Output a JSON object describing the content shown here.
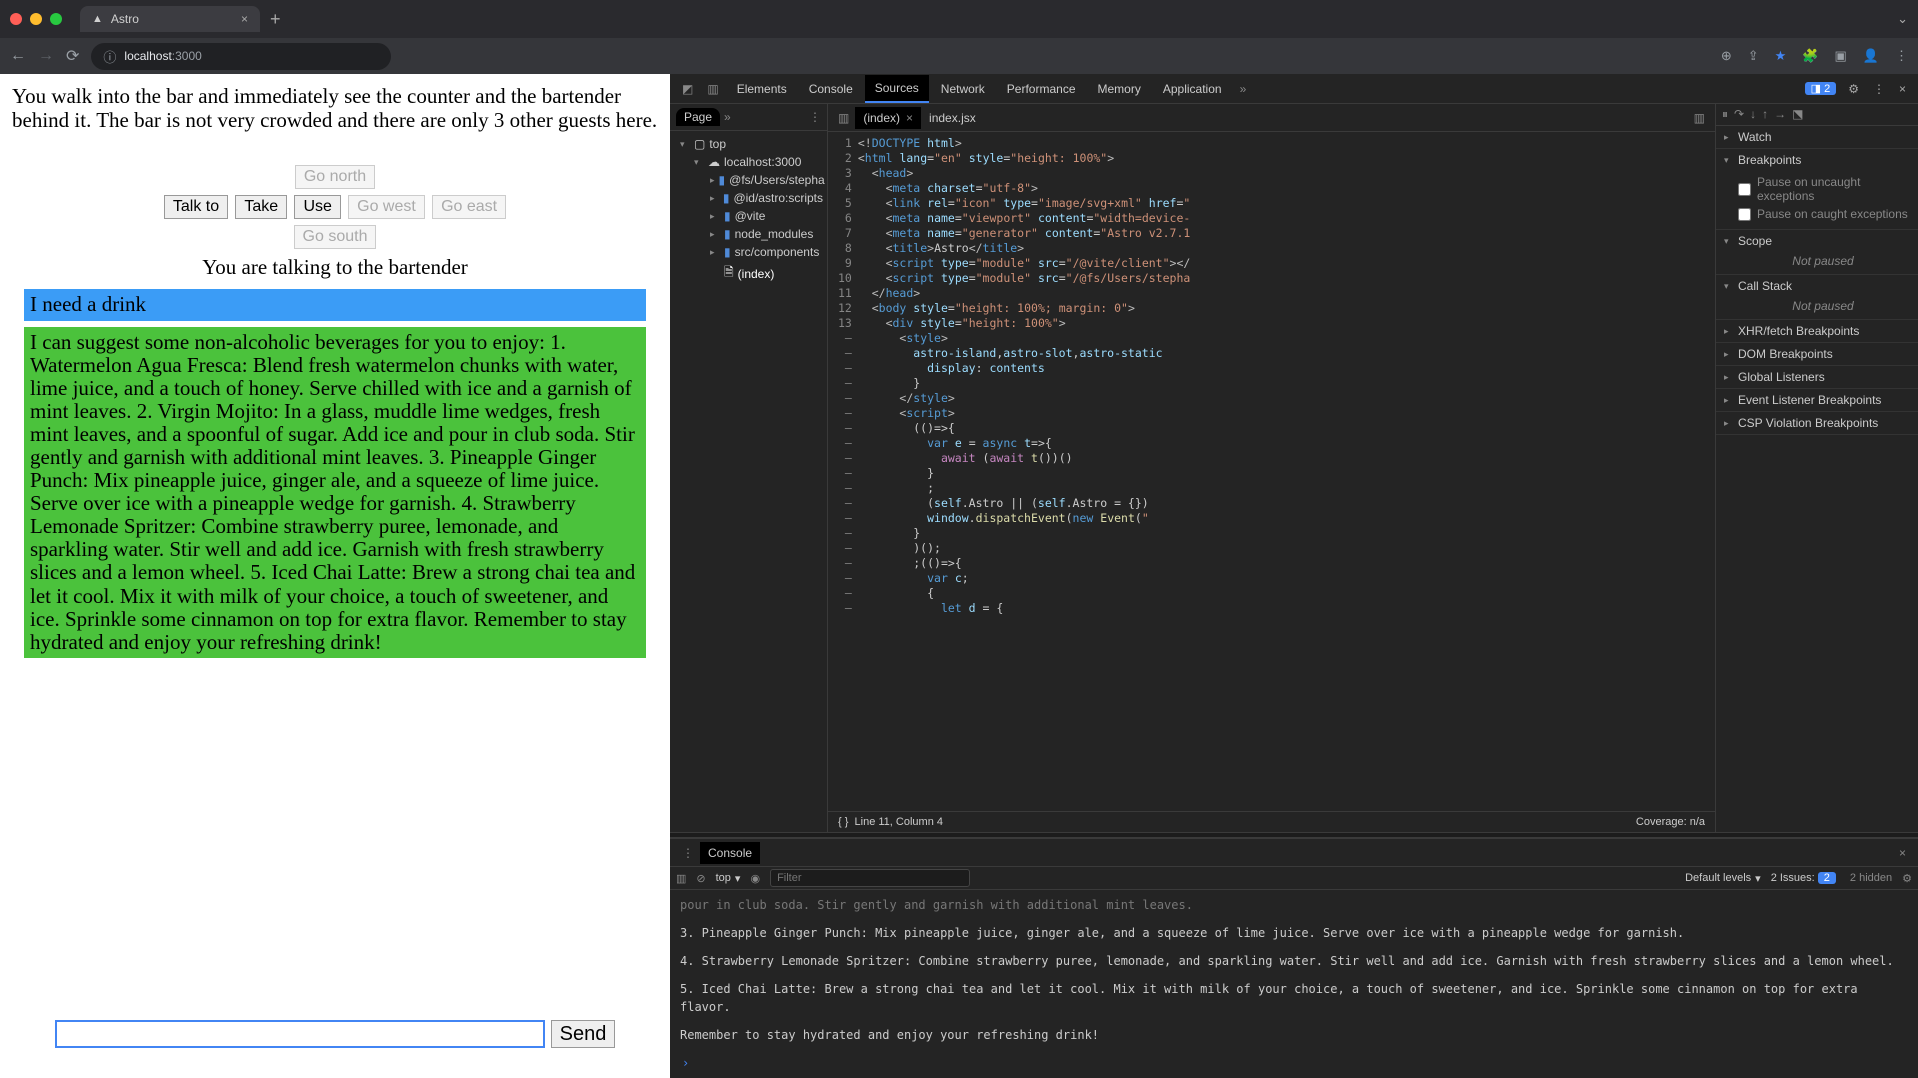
{
  "browser": {
    "tab_title": "Astro",
    "url_host": "localhost",
    "url_port": ":3000"
  },
  "page": {
    "description": "You walk into the bar and immediately see the counter and the bartender behind it. The bar is not very crowded and there are only 3 other guests here.",
    "buttons": {
      "talk": "Talk to",
      "take": "Take",
      "use": "Use",
      "north": "Go north",
      "south": "Go south",
      "east": "Go east",
      "west": "Go west"
    },
    "talking_to": "You are talking to the bartender",
    "user_msg": "I need a drink",
    "bot_msg": "I can suggest some non-alcoholic beverages for you to enjoy: 1. Watermelon Agua Fresca: Blend fresh watermelon chunks with water, lime juice, and a touch of honey. Serve chilled with ice and a garnish of mint leaves. 2. Virgin Mojito: In a glass, muddle lime wedges, fresh mint leaves, and a spoonful of sugar. Add ice and pour in club soda. Stir gently and garnish with additional mint leaves. 3. Pineapple Ginger Punch: Mix pineapple juice, ginger ale, and a squeeze of lime juice. Serve over ice with a pineapple wedge for garnish. 4. Strawberry Lemonade Spritzer: Combine strawberry puree, lemonade, and sparkling water. Stir well and add ice. Garnish with fresh strawberry slices and a lemon wheel. 5. Iced Chai Latte: Brew a strong chai tea and let it cool. Mix it with milk of your choice, a touch of sweetener, and ice. Sprinkle some cinnamon on top for extra flavor. Remember to stay hydrated and enjoy your refreshing drink!",
    "send": "Send"
  },
  "devtools": {
    "tabs": [
      "Elements",
      "Console",
      "Sources",
      "Network",
      "Performance",
      "Memory",
      "Application"
    ],
    "active_tab": "Sources",
    "issues_badge": "2",
    "navigator": {
      "page_tab": "Page",
      "top": "top",
      "host": "localhost:3000",
      "folders": [
        "@fs/Users/stepha",
        "@id/astro:scripts",
        "@vite",
        "node_modules",
        "src/components"
      ],
      "file": "(index)"
    },
    "editor": {
      "tabs": [
        "(index)",
        "index.jsx"
      ],
      "code_lines": [
        {
          "n": "1",
          "h": "<span class='t-punc'>&lt;!</span><span class='t-tag'>DOCTYPE</span> <span class='t-attr'>html</span><span class='t-punc'>&gt;</span>"
        },
        {
          "n": "2",
          "h": "<span class='t-punc'>&lt;</span><span class='t-tag'>html</span> <span class='t-attr'>lang</span>=<span class='t-str'>\"en\"</span> <span class='t-attr'>style</span>=<span class='t-str'>\"height: 100%\"</span><span class='t-punc'>&gt;</span>"
        },
        {
          "n": "3",
          "h": "  <span class='t-punc'>&lt;</span><span class='t-tag'>head</span><span class='t-punc'>&gt;</span>"
        },
        {
          "n": "4",
          "h": "    <span class='t-punc'>&lt;</span><span class='t-tag'>meta</span> <span class='t-attr'>charset</span>=<span class='t-str'>\"utf-8\"</span><span class='t-punc'>&gt;</span>"
        },
        {
          "n": "5",
          "h": "    <span class='t-punc'>&lt;</span><span class='t-tag'>link</span> <span class='t-attr'>rel</span>=<span class='t-str'>\"icon\"</span> <span class='t-attr'>type</span>=<span class='t-str'>\"image/svg+xml\"</span> <span class='t-attr'>href</span>=<span class='t-str'>\""
        },
        {
          "n": "6",
          "h": "    <span class='t-punc'>&lt;</span><span class='t-tag'>meta</span> <span class='t-attr'>name</span>=<span class='t-str'>\"viewport\"</span> <span class='t-attr'>content</span>=<span class='t-str'>\"width=device-"
        },
        {
          "n": "7",
          "h": "    <span class='t-punc'>&lt;</span><span class='t-tag'>meta</span> <span class='t-attr'>name</span>=<span class='t-str'>\"generator\"</span> <span class='t-attr'>content</span>=<span class='t-str'>\"Astro v2.7.1"
        },
        {
          "n": "8",
          "h": "    <span class='t-punc'>&lt;</span><span class='t-tag'>title</span><span class='t-punc'>&gt;</span>Astro<span class='t-punc'>&lt;/</span><span class='t-tag'>title</span><span class='t-punc'>&gt;</span>"
        },
        {
          "n": "9",
          "h": "    <span class='t-punc'>&lt;</span><span class='t-tag'>script</span> <span class='t-attr'>type</span>=<span class='t-str'>\"module\"</span> <span class='t-attr'>src</span>=<span class='t-str'>\"/@vite/client\"</span><span class='t-punc'>&gt;&lt;/"
        },
        {
          "n": "10",
          "h": "    <span class='t-punc'>&lt;</span><span class='t-tag'>script</span> <span class='t-attr'>type</span>=<span class='t-str'>\"module\"</span> <span class='t-attr'>src</span>=<span class='t-str'>\"/@fs/Users/stepha"
        },
        {
          "n": "11",
          "h": "  <span class='t-punc'>&lt;/</span><span class='t-tag'>head</span><span class='t-punc'>&gt;</span>"
        },
        {
          "n": "12",
          "h": "  <span class='t-punc'>&lt;</span><span class='t-tag'>body</span> <span class='t-attr'>style</span>=<span class='t-str'>\"height: 100%; margin: 0\"</span><span class='t-punc'>&gt;</span>"
        },
        {
          "n": "13",
          "h": "    <span class='t-punc'>&lt;</span><span class='t-tag'>div</span> <span class='t-attr'>style</span>=<span class='t-str'>\"height: 100%\"</span><span class='t-punc'>&gt;</span>"
        },
        {
          "n": "–",
          "h": "      <span class='t-punc'>&lt;</span><span class='t-tag'>style</span><span class='t-punc'>&gt;</span>"
        },
        {
          "n": "–",
          "h": "        <span class='t-var'>astro-island</span>,<span class='t-var'>astro-slot</span>,<span class='t-var'>astro-static</span>"
        },
        {
          "n": "–",
          "h": "          <span class='t-attr'>display</span>: <span class='t-var'>contents</span>"
        },
        {
          "n": "–",
          "h": "        }"
        },
        {
          "n": "–",
          "h": "      <span class='t-punc'>&lt;/</span><span class='t-tag'>style</span><span class='t-punc'>&gt;</span>"
        },
        {
          "n": "–",
          "h": "      <span class='t-punc'>&lt;</span><span class='t-tag'>script</span><span class='t-punc'>&gt;</span>"
        },
        {
          "n": "–",
          "h": "        (()=&gt;{"
        },
        {
          "n": "–",
          "h": "          <span class='t-kw2'>var</span> <span class='t-var'>e</span> = <span class='t-kw2'>async</span> <span class='t-var'>t</span>=&gt;{"
        },
        {
          "n": "–",
          "h": "            <span class='t-kw'>await</span> (<span class='t-kw'>await</span> <span class='t-fn'>t</span>())()"
        },
        {
          "n": "–",
          "h": "          }"
        },
        {
          "n": "–",
          "h": "          ;"
        },
        {
          "n": "–",
          "h": "          (<span class='t-var'>self</span>.Astro || (<span class='t-var'>self</span>.Astro = {})"
        },
        {
          "n": "–",
          "h": "          <span class='t-var'>window</span>.<span class='t-fn'>dispatchEvent</span>(<span class='t-kw2'>new</span> <span class='t-fn'>Event</span>(<span class='t-str'>\""
        },
        {
          "n": "–",
          "h": "        }"
        },
        {
          "n": "–",
          "h": "        )();"
        },
        {
          "n": "–",
          "h": "        ;(()=&gt;{"
        },
        {
          "n": "–",
          "h": "          <span class='t-kw2'>var</span> <span class='t-var'>c</span>;"
        },
        {
          "n": "–",
          "h": "          {"
        },
        {
          "n": "–",
          "h": "            <span class='t-kw2'>let</span> <span class='t-var'>d</span> = {"
        }
      ],
      "status_line": "Line 11, Column 4",
      "coverage": "Coverage: n/a"
    },
    "debugger": {
      "sections": {
        "watch": "Watch",
        "breakpoints": "Breakpoints",
        "uncaught": "Pause on uncaught exceptions",
        "caught": "Pause on caught exceptions",
        "scope": "Scope",
        "not_paused": "Not paused",
        "callstack": "Call Stack",
        "xhr": "XHR/fetch Breakpoints",
        "dom": "DOM Breakpoints",
        "global": "Global Listeners",
        "event": "Event Listener Breakpoints",
        "csp": "CSP Violation Breakpoints"
      }
    },
    "console": {
      "tab": "Console",
      "context": "top",
      "filter_placeholder": "Filter",
      "levels": "Default levels",
      "issues": "2 Issues:",
      "issues_n": "2",
      "hidden": "2 hidden",
      "lines": [
        "pour in club soda. Stir gently and garnish with additional mint leaves.",
        "3. Pineapple Ginger Punch: Mix pineapple juice, ginger ale, and a squeeze of lime juice. Serve over ice with a pineapple wedge for garnish.",
        "4. Strawberry Lemonade Spritzer: Combine strawberry puree, lemonade, and sparkling water. Stir well and add ice. Garnish with fresh strawberry slices and a lemon wheel.",
        "5. Iced Chai Latte: Brew a strong chai tea and let it cool. Mix it with milk of your choice, a touch of sweetener, and ice. Sprinkle some cinnamon on top for extra flavor.",
        "Remember to stay hydrated and enjoy your refreshing drink!"
      ]
    }
  }
}
